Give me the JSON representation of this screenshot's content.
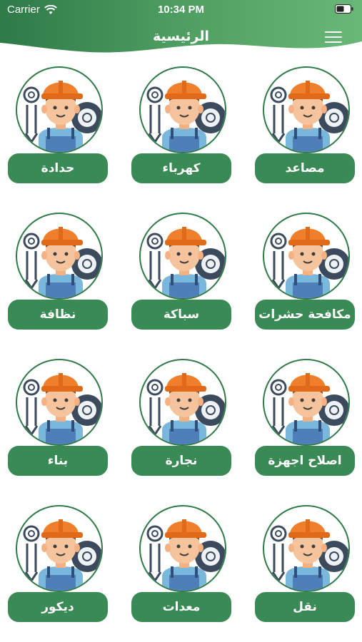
{
  "status_bar": {
    "carrier": "Carrier",
    "time": "10:34 PM"
  },
  "header": {
    "title": "الرئيسية"
  },
  "colors": {
    "header_green_light": "#5fb170",
    "header_green_dark": "#2e7a49",
    "button_green": "#3a8a55"
  },
  "services": [
    {
      "label": "مصاعد"
    },
    {
      "label": "كهرباء"
    },
    {
      "label": "حدادة"
    },
    {
      "label": "مكافحة حشرات"
    },
    {
      "label": "سباكة"
    },
    {
      "label": "نظافة"
    },
    {
      "label": "اصلاح اجهزة"
    },
    {
      "label": "نجارة"
    },
    {
      "label": "بناء"
    },
    {
      "label": "نقل"
    },
    {
      "label": "معدات"
    },
    {
      "label": "ديكور"
    }
  ]
}
